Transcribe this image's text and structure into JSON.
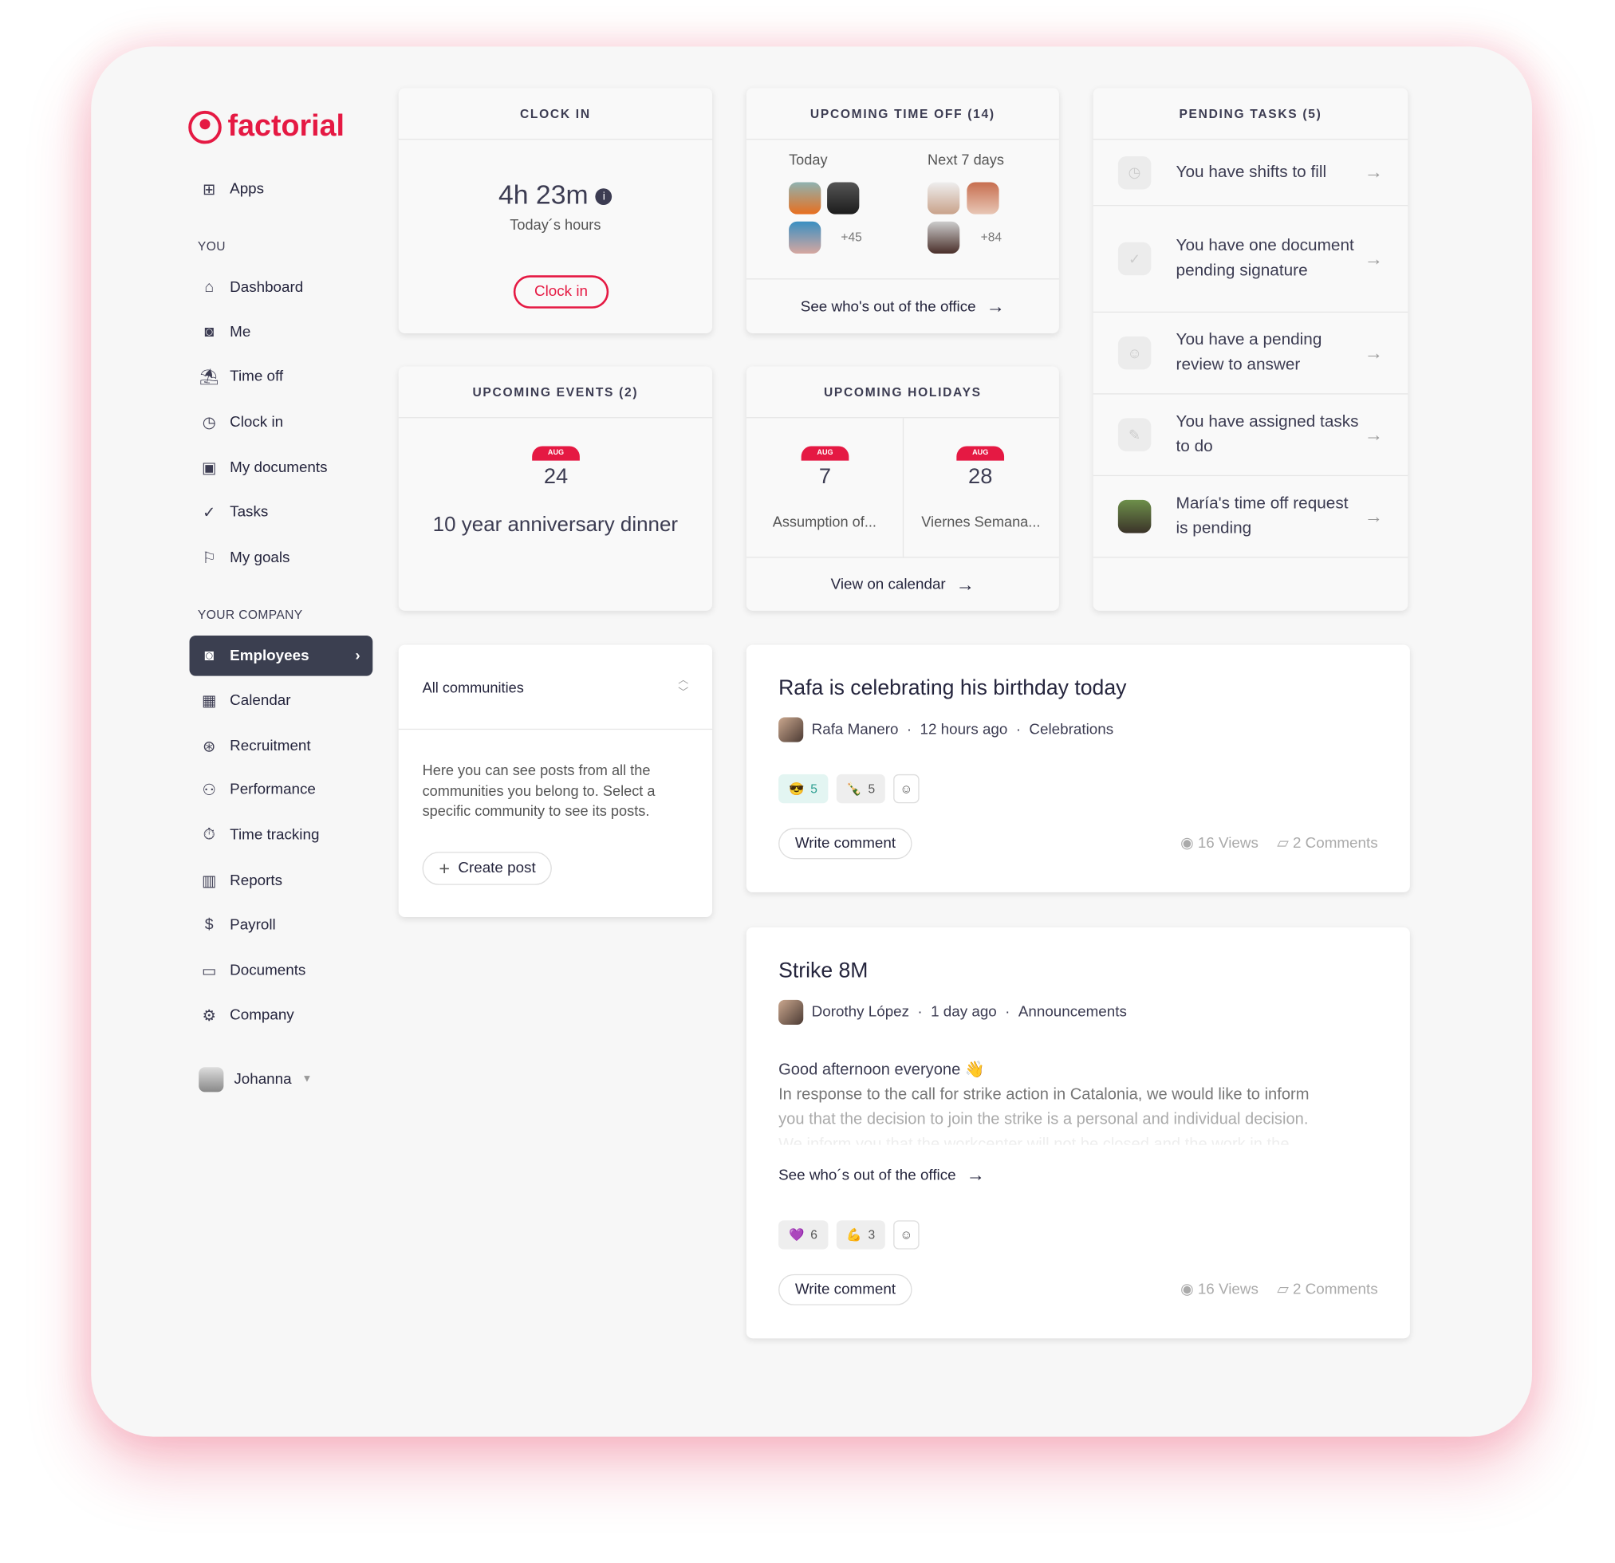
{
  "brand": {
    "name": "factorial",
    "color": "#e51943"
  },
  "sidebar": {
    "apps": {
      "label": "Apps",
      "icon": "apps-icon"
    },
    "section_you": "YOU",
    "you_items": [
      {
        "label": "Dashboard",
        "icon": "home-icon"
      },
      {
        "label": "Me",
        "icon": "user-icon"
      },
      {
        "label": "Time off",
        "icon": "palm-tree-icon"
      },
      {
        "label": "Clock in",
        "icon": "clock-icon"
      },
      {
        "label": "My documents",
        "icon": "folder-user-icon"
      },
      {
        "label": "Tasks",
        "icon": "check-circle-icon"
      },
      {
        "label": "My goals",
        "icon": "flag-icon"
      }
    ],
    "section_company": "YOUR COMPANY",
    "company_items": [
      {
        "label": "Employees",
        "icon": "employees-icon",
        "active": true
      },
      {
        "label": "Calendar",
        "icon": "calendar-icon"
      },
      {
        "label": "Recruitment",
        "icon": "recruitment-icon"
      },
      {
        "label": "Performance",
        "icon": "performance-icon"
      },
      {
        "label": "Time tracking",
        "icon": "stopwatch-icon"
      },
      {
        "label": "Reports",
        "icon": "chart-icon"
      },
      {
        "label": "Payroll",
        "icon": "payroll-icon"
      },
      {
        "label": "Documents",
        "icon": "folder-icon"
      },
      {
        "label": "Company",
        "icon": "gear-icon"
      }
    ],
    "user": {
      "name": "Johanna"
    }
  },
  "clock_in": {
    "title": "CLOCK IN",
    "hours": "4h 23m",
    "subtitle": "Today´s hours",
    "button": "Clock in"
  },
  "time_off": {
    "title": "UPCOMING TIME OFF (14)",
    "today_label": "Today",
    "next_label": "Next 7 days",
    "today_more": "+45",
    "next_more": "+84",
    "link": "See who's out of the office"
  },
  "pending_tasks": {
    "title": "PENDING TASKS (5)",
    "items": [
      {
        "text": "You have shifts to fill",
        "icon": "clock-icon"
      },
      {
        "text": "You have one document pending signature",
        "icon": "check-icon"
      },
      {
        "text": "You have a pending review to answer",
        "icon": "review-icon"
      },
      {
        "text": "You have assigned tasks to do",
        "icon": "pencil-icon"
      },
      {
        "text": "María's time off request is pending",
        "icon": "avatar"
      }
    ]
  },
  "events": {
    "title": "UPCOMING EVENTS (2)",
    "month": "AUG",
    "day": "24",
    "name": "10 year anniversary dinner"
  },
  "holidays": {
    "title": "UPCOMING HOLIDAYS",
    "items": [
      {
        "month": "AUG",
        "day": "7",
        "name": "Assumption of..."
      },
      {
        "month": "AUG",
        "day": "28",
        "name": "Viernes Semana..."
      }
    ],
    "link": "View on calendar"
  },
  "communities": {
    "selected": "All communities",
    "description": "Here you can see posts from all the communities you belong to. Select a specific community to see its posts.",
    "create": "Create post"
  },
  "posts": [
    {
      "title": "Rafa is celebrating his birthday today",
      "author": "Rafa Manero",
      "time": "12 hours ago",
      "community": "Celebrations",
      "reactions": [
        {
          "emoji": "😎",
          "count": "5"
        },
        {
          "emoji": "🍾",
          "count": "5"
        }
      ],
      "comment_btn": "Write comment",
      "views": "16 Views",
      "comments": "2 Comments"
    },
    {
      "title": "Strike 8M",
      "author": "Dorothy López",
      "time": "1 day ago",
      "community": "Announcements",
      "greeting": "Good afternoon everyone 👋",
      "body1": "In response to the call for strike action in Catalonia, we would like to inform",
      "body2": "you that the decision to join the strike is a personal and individual decision.",
      "body3": "We inform you that the workcenter will not be closed and the work in the...",
      "link": "See who´s out of the office",
      "reactions": [
        {
          "emoji": "💜",
          "count": "6"
        },
        {
          "emoji": "💪",
          "count": "3"
        }
      ],
      "comment_btn": "Write comment",
      "views": "16 Views",
      "comments": "2 Comments"
    }
  ]
}
